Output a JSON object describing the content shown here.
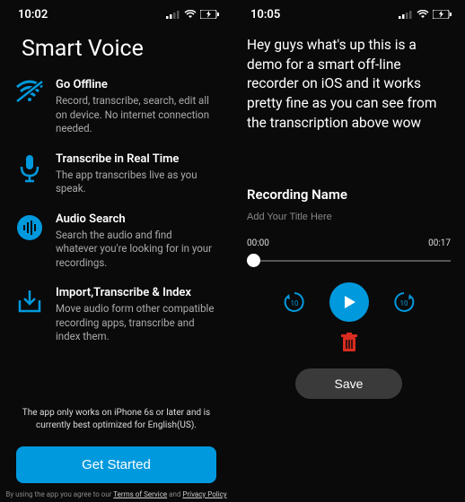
{
  "left": {
    "status_time": "10:02",
    "title": "Smart Voice",
    "features": [
      {
        "heading": "Go Offline",
        "body": "Record, transcribe, search, edit all on device. No internet connection needed."
      },
      {
        "heading": "Transcribe in Real Time",
        "body": "The app transcribes live as you speak."
      },
      {
        "heading": "Audio Search",
        "body": "Search the audio and find whatever you're looking for in your recordings."
      },
      {
        "heading": "Import,Transcribe & Index",
        "body": "Move audio form other compatible recording apps, transcribe and index them."
      }
    ],
    "footer_note": "The app only works on iPhone 6s or later and is currently best optimized for English(US).",
    "cta_label": "Get Started",
    "legal_prefix": "By using the app you agree to our ",
    "legal_terms": "Terms of Service",
    "legal_and": " and ",
    "legal_privacy": "Privacy Policy"
  },
  "right": {
    "status_time": "10:05",
    "transcript": "Hey guys what's up this is a demo for a smart off-line recorder on iOS and it works pretty fine as you can see from the transcription above wow",
    "recording_label": "Recording Name",
    "recording_placeholder": "Add Your Title Here",
    "time_current": "00:00",
    "time_total": "00:17",
    "skip_amount": "10",
    "save_label": "Save"
  },
  "colors": {
    "accent": "#0099dd",
    "danger": "#d92b1f"
  }
}
